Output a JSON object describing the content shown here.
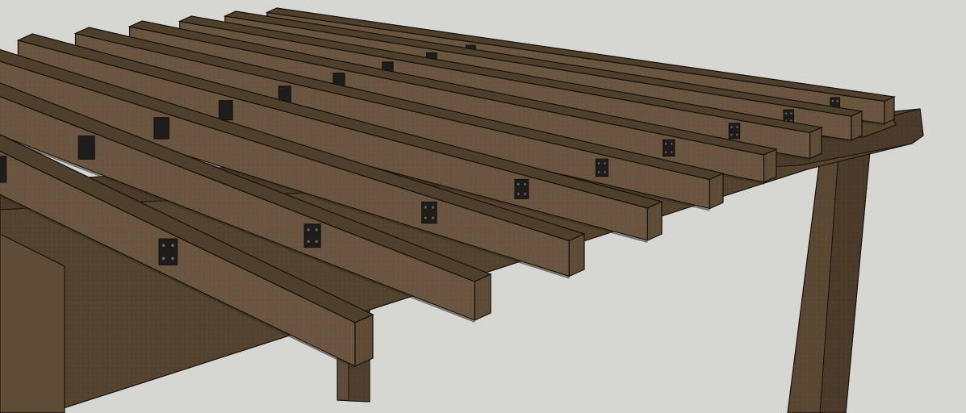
{
  "scene": {
    "subject": "pergola-rafters",
    "rafter_count": 9,
    "post_count": 3,
    "colors": {
      "background": "#d6d6d2",
      "wood_top": "#6a5640",
      "wood_side": "#4f3f2d",
      "wood_end": "#5f4c37",
      "wood_dark": "#3b2f22",
      "outline": "#16110c",
      "bracket": "#1f1d1c",
      "bracket_hole": "#6b6560"
    }
  }
}
